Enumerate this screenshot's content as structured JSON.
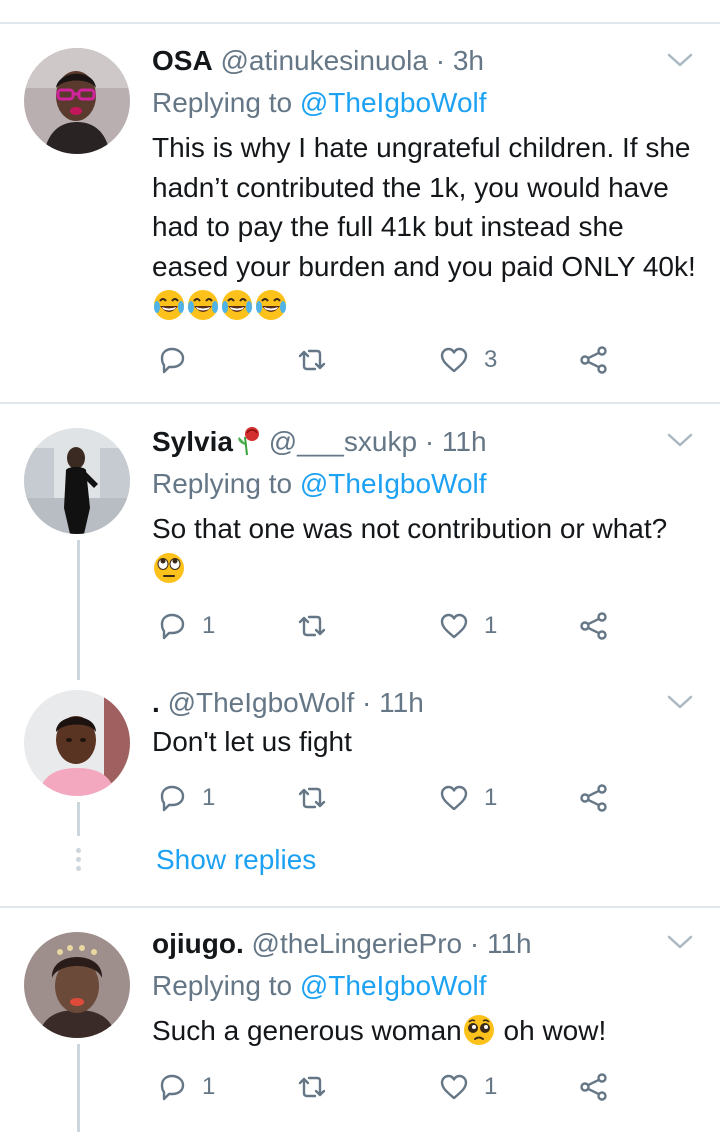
{
  "replying_prefix": "Replying to",
  "tweets": [
    {
      "name": "OSA",
      "handle": "@atinukesinuola",
      "time": "3h",
      "reply_to": "@TheIgboWolf",
      "text": "This is why I hate ungrateful children. If she hadn’t contributed the 1k, you would have had to pay the full 41k but instead she eased your burden and you paid ONLY 40k!",
      "emoji": [
        "face-with-tears-of-joy",
        "face-with-tears-of-joy",
        "face-with-tears-of-joy",
        "face-with-tears-of-joy"
      ],
      "replies": "",
      "retweets": "",
      "likes": "3"
    },
    {
      "name": "Sylvia",
      "name_emoji": "wilted-rose",
      "handle": "@___sxukp",
      "time": "11h",
      "reply_to": "@TheIgboWolf",
      "text": "So that one was not contribution or what?",
      "emoji": [
        "face-with-rolling-eyes"
      ],
      "replies": "1",
      "retweets": "",
      "likes": "1"
    },
    {
      "name": ".",
      "handle": "@TheIgboWolf",
      "time": "11h",
      "text": "Don't let us fight",
      "replies": "1",
      "retweets": "",
      "likes": "1",
      "show_replies": "Show replies"
    },
    {
      "name": "ojiugo.",
      "handle": "@theLingeriePro",
      "time": "11h",
      "reply_to": "@TheIgboWolf",
      "text_before_emoji": "Such a generous woman",
      "emoji": [
        "pleading-face"
      ],
      "text_after_emoji": " oh wow!",
      "replies": "1",
      "retweets": "",
      "likes": "1"
    }
  ],
  "icons": {
    "reply": "reply-icon",
    "retweet": "retweet-icon",
    "like": "heart-icon",
    "share": "share-icon",
    "more": "chevron-down-icon"
  },
  "colors": {
    "link": "#1da1f2",
    "secondary_text": "#657786",
    "divider": "#e1e8ed",
    "thread_line": "#ccd6dd"
  }
}
